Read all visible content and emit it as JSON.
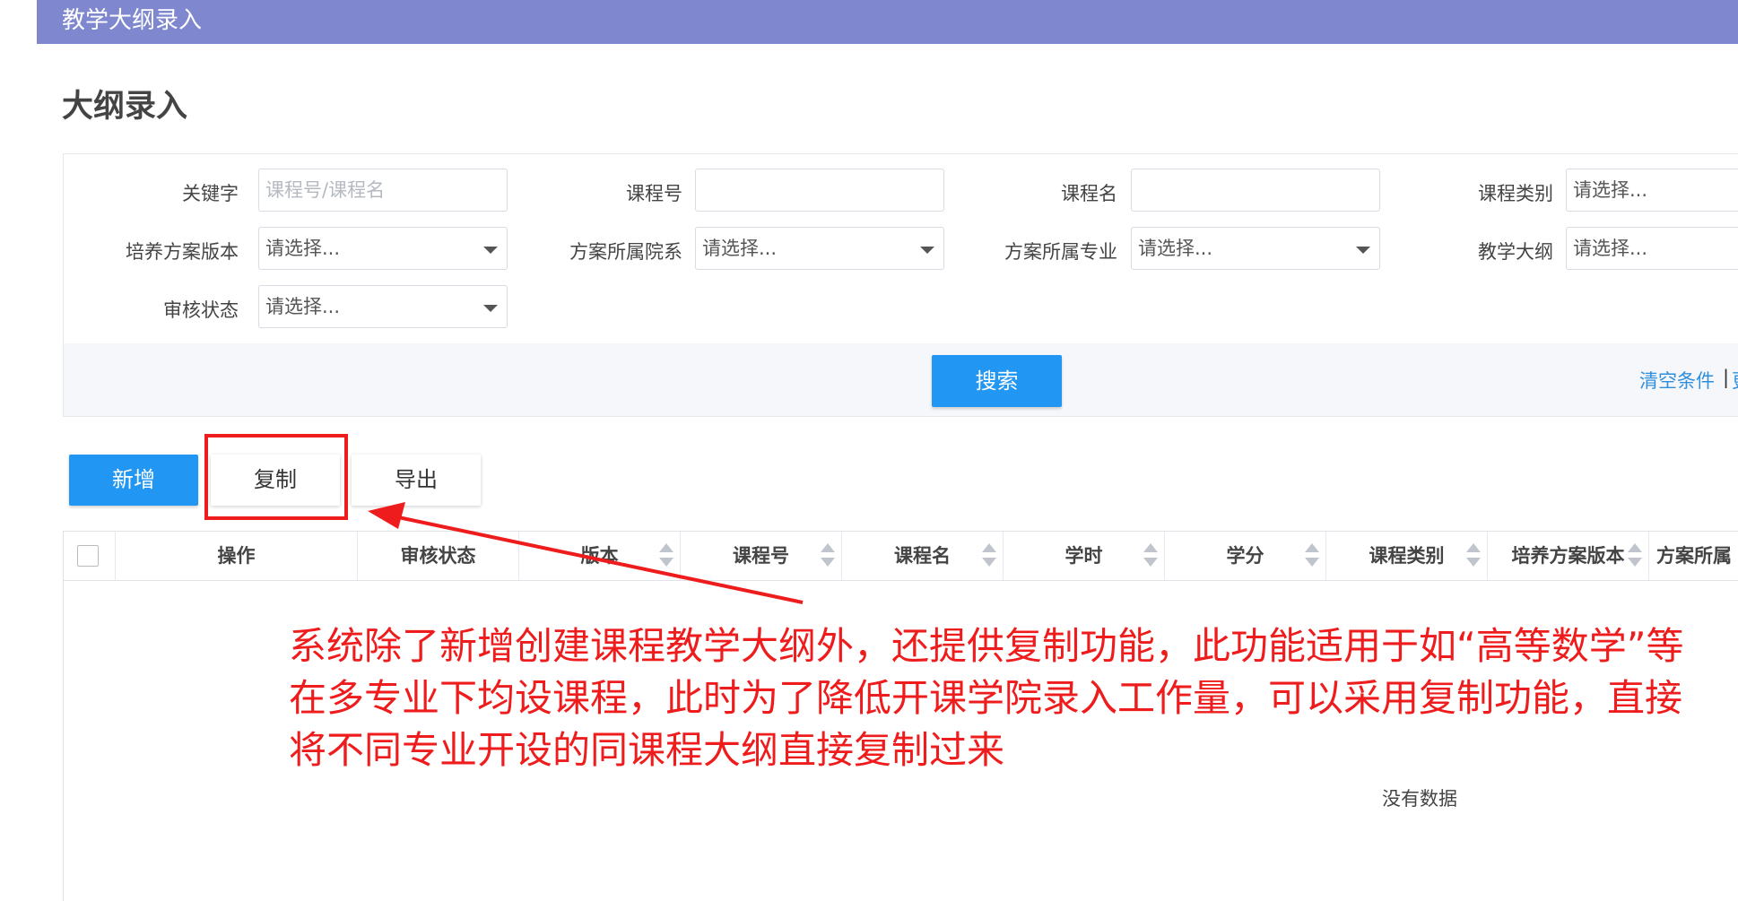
{
  "header": {
    "title": "教学大纲录入"
  },
  "page": {
    "title": "大纲录入"
  },
  "search": {
    "keyword_label": "关键字",
    "keyword_placeholder": "课程号/课程名",
    "course_no_label": "课程号",
    "course_name_label": "课程名",
    "course_type_label": "课程类别",
    "course_type_value": "请选择...",
    "plan_version_label": "培养方案版本",
    "plan_version_value": "请选择...",
    "plan_dept_label": "方案所属院系",
    "plan_dept_value": "请选择...",
    "plan_major_label": "方案所属专业",
    "plan_major_value": "请选择...",
    "syllabus_label": "教学大纲",
    "syllabus_value": "请选择...",
    "review_status_label": "审核状态",
    "review_status_value": "请选择...",
    "search_button": "搜索",
    "clear_link": "清空条件",
    "separator": "|",
    "more_link_partial": "更"
  },
  "toolbar": {
    "add_label": "新增",
    "copy_label": "复制",
    "export_label": "导出"
  },
  "table": {
    "columns": [
      "操作",
      "审核状态",
      "版本",
      "课程号",
      "课程名",
      "学时",
      "学分",
      "课程类别",
      "培养方案版本",
      "方案所属"
    ],
    "empty_text": "没有数据"
  },
  "annotation": {
    "color": "#ee1c1c",
    "text": "系统除了新增创建课程教学大纲外，还提供复制功能，此功能适用于如“高等数学”等在多专业下均设课程，此时为了降低开课学院录入工作量，可以采用复制功能，直接将不同专业开设的同课程大纲直接复制过来"
  },
  "colors": {
    "header_bg": "#7f88cf",
    "primary": "#2196f3",
    "link": "#2f8fdd"
  }
}
